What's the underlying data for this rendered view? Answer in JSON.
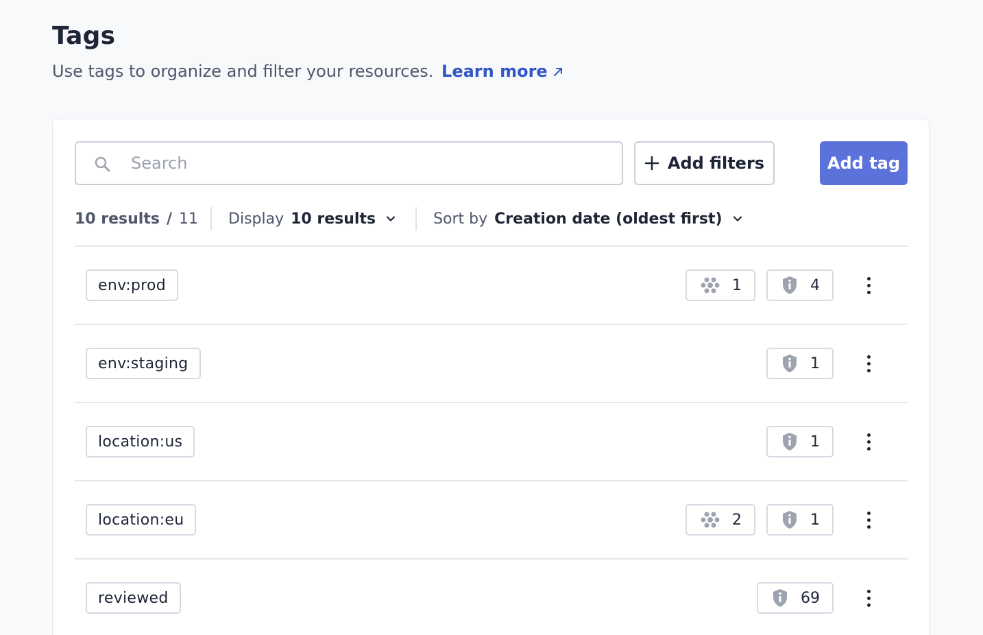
{
  "header": {
    "title": "Tags",
    "subtitle": "Use tags to organize and filter your resources.",
    "learn_more": "Learn more"
  },
  "toolbar": {
    "search_placeholder": "Search",
    "add_filters_label": "Add filters",
    "add_tag_label": "Add tag"
  },
  "results": {
    "count": "10 results",
    "separator": "/",
    "total": "11",
    "display_label": "Display",
    "display_value": "10 results",
    "sort_label": "Sort by",
    "sort_value": "Creation date (oldest first)"
  },
  "icons": {
    "search": "search-icon",
    "plus": "plus-icon",
    "external_link": "external-link-icon",
    "chevron": "chevron-down-icon",
    "hub": "cluster-icon",
    "shield": "shield-info-icon",
    "more": "kebab-menu-icon"
  },
  "colors": {
    "accent": "#5a72d9",
    "link": "#3257c4",
    "icon_gray": "#9ea3b0"
  },
  "tags": [
    {
      "name": "env:prod",
      "cluster_count": "1",
      "policy_count": "4"
    },
    {
      "name": "env:staging",
      "cluster_count": null,
      "policy_count": "1"
    },
    {
      "name": "location:us",
      "cluster_count": null,
      "policy_count": "1"
    },
    {
      "name": "location:eu",
      "cluster_count": "2",
      "policy_count": "1"
    },
    {
      "name": "reviewed",
      "cluster_count": null,
      "policy_count": "69"
    }
  ]
}
